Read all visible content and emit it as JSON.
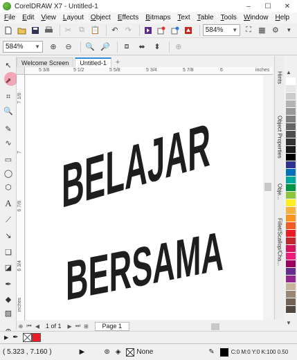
{
  "window": {
    "title": "CorelDRAW X7 - Untitled-1",
    "minimize": "–",
    "maximize": "☐",
    "close": "✕"
  },
  "menu": [
    "File",
    "Edit",
    "View",
    "Layout",
    "Object",
    "Effects",
    "Bitmaps",
    "Text",
    "Table",
    "Tools",
    "Window",
    "Help"
  ],
  "toolbar": {
    "zoom_value": "584%"
  },
  "property_bar": {
    "zoom_value": "584%"
  },
  "tabs": [
    "Welcome Screen",
    "Untitled-1"
  ],
  "ruler": {
    "h_labels": [
      "5 3/8",
      "5 1/2",
      "5 5/8",
      "5 3/4",
      "5 7/8",
      "6"
    ],
    "v_labels": [
      "7 1/8",
      "7",
      "6 7/8",
      "6 3/4"
    ],
    "unit": "inches",
    "v_unit": "inches"
  },
  "canvas": {
    "line1": "BELAJAR",
    "line2": "BERSAMA",
    "text_color": "#1e1e1e"
  },
  "docker": {
    "tabs": [
      "Hints",
      "Object Properties",
      "Obje...",
      "Fillet/Scallop/Cha..."
    ]
  },
  "palette": {
    "colors": [
      "#ffffff",
      "#e6e6e6",
      "#cccccc",
      "#b3b3b3",
      "#999999",
      "#808080",
      "#666666",
      "#4d4d4d",
      "#333333",
      "#1a1a1a",
      "#000000",
      "#2e3192",
      "#0071bc",
      "#00a99d",
      "#009245",
      "#8cc63f",
      "#fcee21",
      "#fbb03b",
      "#f7931e",
      "#f15a24",
      "#ed1c24",
      "#c1272d",
      "#d4145a",
      "#ed1e79",
      "#9e005d",
      "#662d91",
      "#93278f",
      "#c7b299",
      "#998675",
      "#736357",
      "#534741"
    ]
  },
  "pagebar": {
    "page_info": "1 of 1",
    "page_tab": "Page 1"
  },
  "status": {
    "coords": "( 5.323 , 7.160 )",
    "outline": "None",
    "fill": "C:0 M:0 Y:0 K:100  0.50"
  },
  "colors": {
    "accent": "#2b8fd8",
    "fill_red": "#ed1c24"
  }
}
